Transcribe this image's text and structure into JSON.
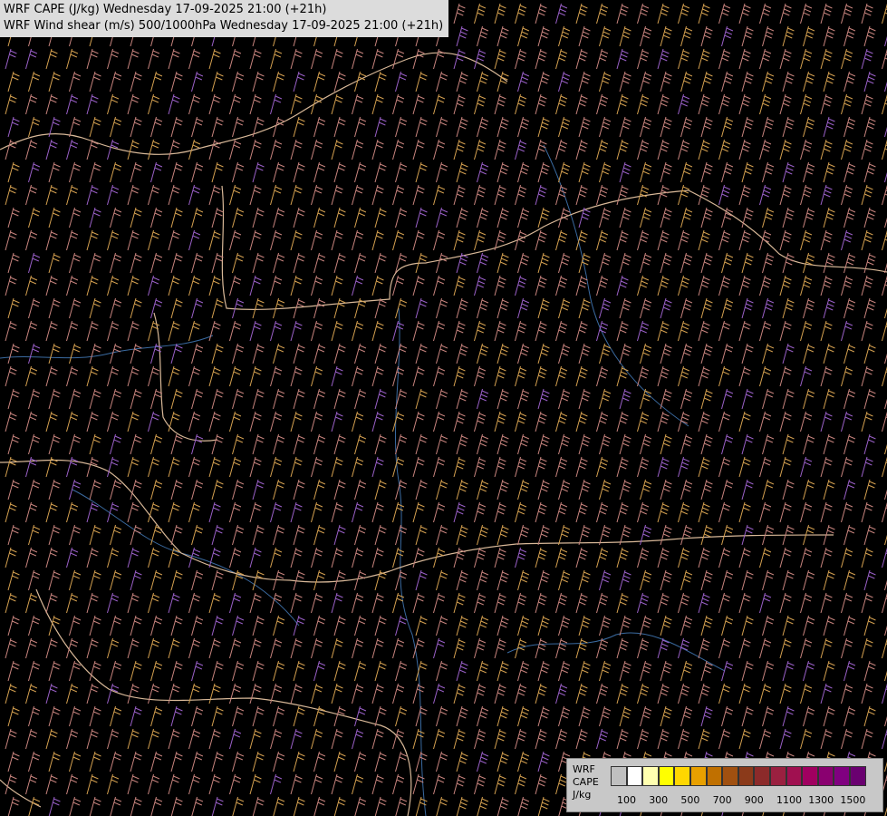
{
  "title": {
    "line1": "WRF CAPE (J/kg) Wednesday 17-09-2025 21:00 (+21h)",
    "line2": "WRF Wind shear (m/s) 500/1000hPa Wednesday 17-09-2025 21:00 (+21h)"
  },
  "legend": {
    "model": "WRF",
    "field": "CAPE",
    "unit": "J/kg",
    "ticks": [
      "100",
      "300",
      "500",
      "700",
      "900",
      "1100",
      "1300",
      "1500"
    ],
    "colors": [
      "#c0c0c0",
      "#ffffff",
      "#ffffb0",
      "#ffff00",
      "#ffd700",
      "#e8a000",
      "#c07000",
      "#a05010",
      "#8b3a1a",
      "#8c2a2a",
      "#9a2040",
      "#a01050",
      "#a00060",
      "#8a0070",
      "#800080",
      "#6a0070"
    ]
  },
  "colors": {
    "background": "#000000",
    "barb_shear_low": "#c8847e",
    "barb_shear_mid": "#d4a050",
    "barb_shear_high": "#ffff00",
    "barb_shear_calm": "#9a60c8",
    "barb_shear_max": "#ff00ff",
    "barb_shear_strong": "#f07878",
    "border": "#d8b898",
    "river": "#3a6aa0"
  }
}
